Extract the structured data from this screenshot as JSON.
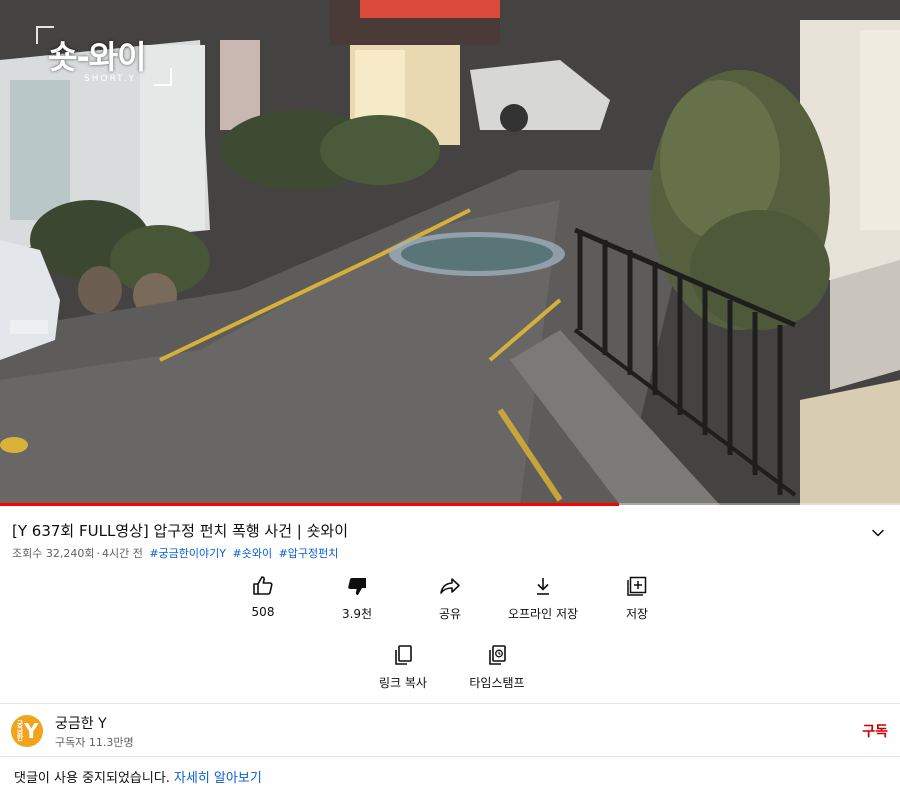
{
  "video": {
    "watermark_title": "숏-와이",
    "watermark_sub": "SHORT.Y",
    "progress_fraction": 0.688
  },
  "title": "[Y 637회 FULL영상] 압구정 펀치 폭행 사건 | 숏와이",
  "meta": {
    "views": "조회수 32,240회",
    "time": "4시간 전",
    "tags": [
      "#궁금한이야기Y",
      "#숏와이",
      "#압구정펀치"
    ]
  },
  "actions": {
    "like": "508",
    "dislike": "3.9천",
    "share": "공유",
    "offline": "오프라인 저장",
    "save": "저장",
    "copy_link": "링크 복사",
    "timestamp": "타임스탬프"
  },
  "channel": {
    "name": "궁금한 Y",
    "subscribers": "구독자 11.3만명",
    "subscribe": "구독",
    "avatar_small": "궁금한",
    "avatar_big": "Y"
  },
  "comments": {
    "disabled_text": "댓글이 사용 중지되었습니다.",
    "learn_more": "자세히 알아보기"
  },
  "colors": {
    "accent_red": "#ff0000",
    "subscribe_red": "#cc0000",
    "link_blue": "#065fd4",
    "avatar_orange": "#f2a21b"
  },
  "icons": {
    "like": "thumbs-up-icon",
    "dislike": "thumbs-down-icon",
    "share": "share-arrow-icon",
    "offline": "download-icon",
    "save": "add-to-playlist-icon",
    "copy_link": "copy-icon",
    "timestamp": "timestamp-icon",
    "expand": "chevron-down-icon"
  }
}
